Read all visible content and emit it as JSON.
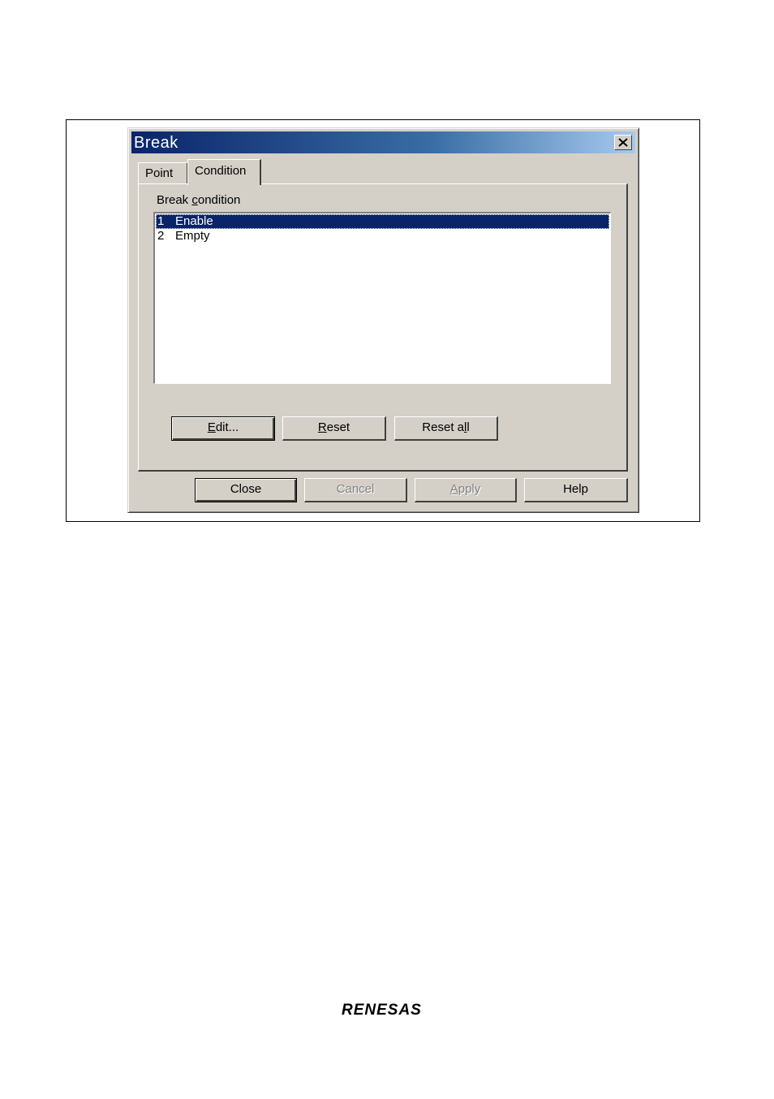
{
  "window": {
    "title": "Break"
  },
  "tabs": [
    {
      "label": "Point",
      "active": false
    },
    {
      "label": "Condition",
      "active": true
    }
  ],
  "condition": {
    "list_label_pre": "Break ",
    "list_label_hot": "c",
    "list_label_post": "ondition",
    "items": [
      {
        "num": "1",
        "text": "Enable",
        "selected": true
      },
      {
        "num": "2",
        "text": "Empty",
        "selected": false
      }
    ],
    "buttons": {
      "edit": {
        "hot": "E",
        "rest": "dit..."
      },
      "reset": {
        "hot": "R",
        "rest": "eset"
      },
      "reset_all": {
        "pre": "Reset a",
        "hot": "l",
        "rest": "l"
      }
    }
  },
  "footer_buttons": {
    "close": "Close",
    "cancel": "Cancel",
    "apply_hot": "A",
    "apply_rest": "pply",
    "help": "Help"
  },
  "logo": "RENESAS",
  "colors": {
    "titlebar_start": "#0a246a",
    "titlebar_end": "#a6caf0",
    "selection": "#0a246a",
    "face": "#d4d0c8"
  }
}
